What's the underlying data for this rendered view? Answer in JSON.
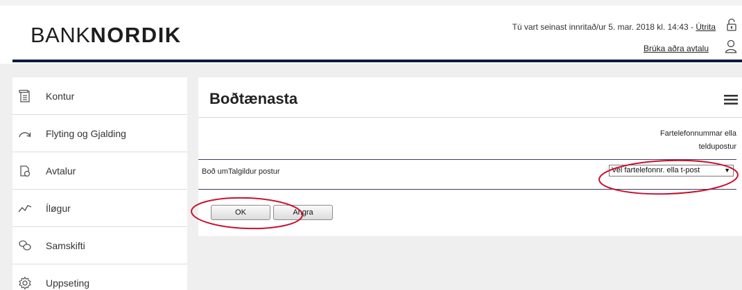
{
  "header": {
    "logo_light": "BANK",
    "logo_bold": "NORDIK",
    "login_text": "Tú vart seinast innritað/ur 5. mar. 2018 kl. 14:43 - ",
    "logout_label": "Útrita",
    "other_agreement_label": "Brúka aðra avtalu",
    "icons": [
      "lock-icon",
      "user-icon"
    ]
  },
  "sidebar": {
    "items": [
      {
        "label": "Kontur",
        "icon": "account-icon"
      },
      {
        "label": "Flyting og Gjalding",
        "icon": "transfer-arrow-icon"
      },
      {
        "label": "Avtalur",
        "icon": "agreement-icon"
      },
      {
        "label": "Íløgur",
        "icon": "investment-chart-icon"
      },
      {
        "label": "Samskifti",
        "icon": "chat-icon"
      },
      {
        "label": "Uppseting",
        "icon": "settings-icon"
      }
    ]
  },
  "main": {
    "title": "Boðtænasta",
    "field_header_line1": "Fartelefonnummar ella",
    "field_header_line2": "teldupostur",
    "row_label": "Boð umTalgildur postur",
    "select_value": "Vel fartelefonnr. ella t-post",
    "ok_label": "OK",
    "cancel_label": "Angra"
  },
  "colors": {
    "header_line": "#0a1e3c",
    "background": "#efefef",
    "annotation": "#c8102e"
  }
}
